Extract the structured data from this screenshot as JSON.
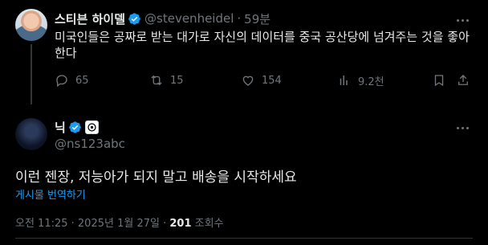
{
  "quoted_post": {
    "author_name": "스티븐 하이델",
    "handle": "@stevenheidel",
    "separator": "·",
    "time_ago": "59분",
    "text": "미국인들은 공짜로 받는 대가로 자신의 데이터를 중국 공산당에 넘겨주는 것을 좋아한다",
    "actions": {
      "replies": "65",
      "reposts": "15",
      "likes": "154",
      "views": "9.2천"
    }
  },
  "reply_post": {
    "author_name": "닉",
    "handle": "@ns123abc",
    "text": "이런 젠장, 저능아가 되지 말고 배송을 시작하세요",
    "translate_label": "게시물 번역하기",
    "timestamp": "오전 11:25 · 2025년 1월 27일 · ",
    "view_count": "201",
    "view_label": " 조회수"
  },
  "colors": {
    "background": "#000000",
    "text_primary": "#e7e9ea",
    "text_secondary": "#71767b",
    "accent": "#1d9bf0",
    "verified_badge": "#1d9bf0"
  },
  "icons": [
    "verified-badge-icon",
    "more-options-icon",
    "reply-icon",
    "repost-icon",
    "like-icon",
    "views-icon",
    "bookmark-icon",
    "share-icon",
    "affiliate-logo-icon"
  ]
}
